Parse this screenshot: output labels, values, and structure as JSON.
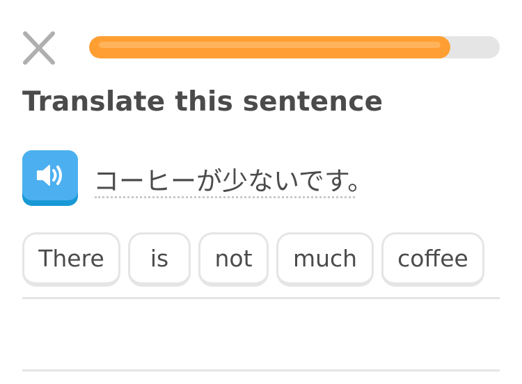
{
  "header": {
    "close_icon": "close-icon",
    "progress_percent": 88
  },
  "challenge": {
    "title": "Translate this sentence",
    "speaker_icon": "speaker-icon",
    "prompt": "コーヒーが少ないです。"
  },
  "answer": {
    "words": [
      "There",
      "is",
      "not",
      "much",
      "coffee"
    ]
  },
  "colors": {
    "progress": "#ff9f33",
    "speaker": "#4cb0f0",
    "text": "#4b4b4b",
    "border": "#e5e5e5"
  }
}
